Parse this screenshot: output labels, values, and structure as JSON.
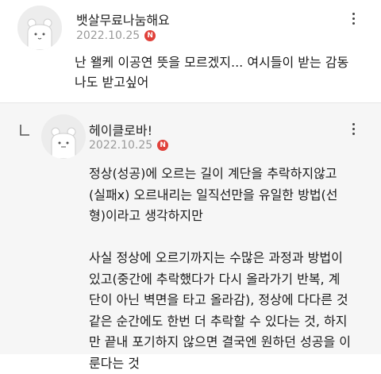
{
  "comments": [
    {
      "username": "뱃살무료나눔해요",
      "date": "2022.10.25",
      "badge": "N",
      "lines": [
        "난 왤케 이공연 뜻을 모르겠지... 여시들이 받는 감동",
        "나도 받고싶어"
      ]
    },
    {
      "username": "헤이클로바!",
      "date": "2022.10.25",
      "badge": "N",
      "lines": [
        "정상(성공)에 오르는 길이 계단을 추락하지않고",
        "(실패x) 오르내리는 일직선만을 유일한 방법(선",
        "형)이라고 생각하지만",
        "",
        "사실 정상에 오르기까지는 수많은 과정과 방법이",
        "있고(중간에 추락했다가 다시 올라가기 반복, 계",
        "단이 아닌 벽면을 타고 올라감), 정상에 다다른 것",
        "같은 순간에도 한번 더 추락할 수 있다는 것, 하지",
        "만 끝내 포기하지 않으면 결국엔 원하던 성공을 이",
        "룬다는 것"
      ]
    }
  ],
  "colors": {
    "badge": "#e0413a",
    "meta": "#9a9a9a",
    "reply_bg": "#f6f6f6"
  }
}
